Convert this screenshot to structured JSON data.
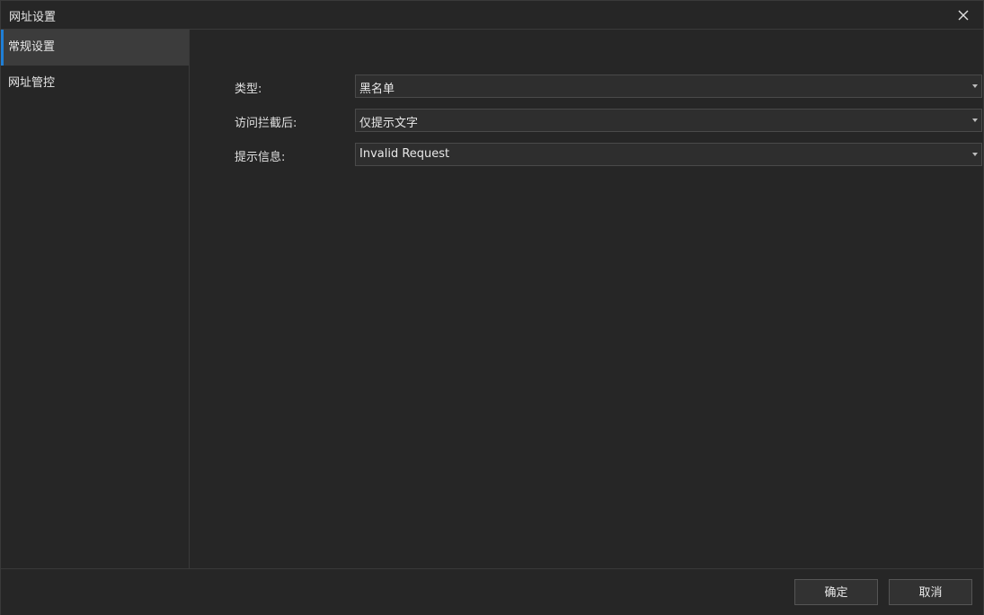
{
  "window": {
    "title": "网址设置"
  },
  "sidebar": {
    "items": [
      {
        "label": "常规设置",
        "active": true
      },
      {
        "label": "网址管控",
        "active": false
      }
    ]
  },
  "form": {
    "type": {
      "label": "类型:",
      "value": "黑名单"
    },
    "after_block": {
      "label": "访问拦截后:",
      "value": "仅提示文字"
    },
    "message": {
      "label": "提示信息:",
      "value": "Invalid Request"
    }
  },
  "footer": {
    "ok_label": "确定",
    "cancel_label": "取消"
  },
  "colors": {
    "accent": "#1f7fd6",
    "background": "#262626",
    "active_item": "#3c3c3c"
  }
}
